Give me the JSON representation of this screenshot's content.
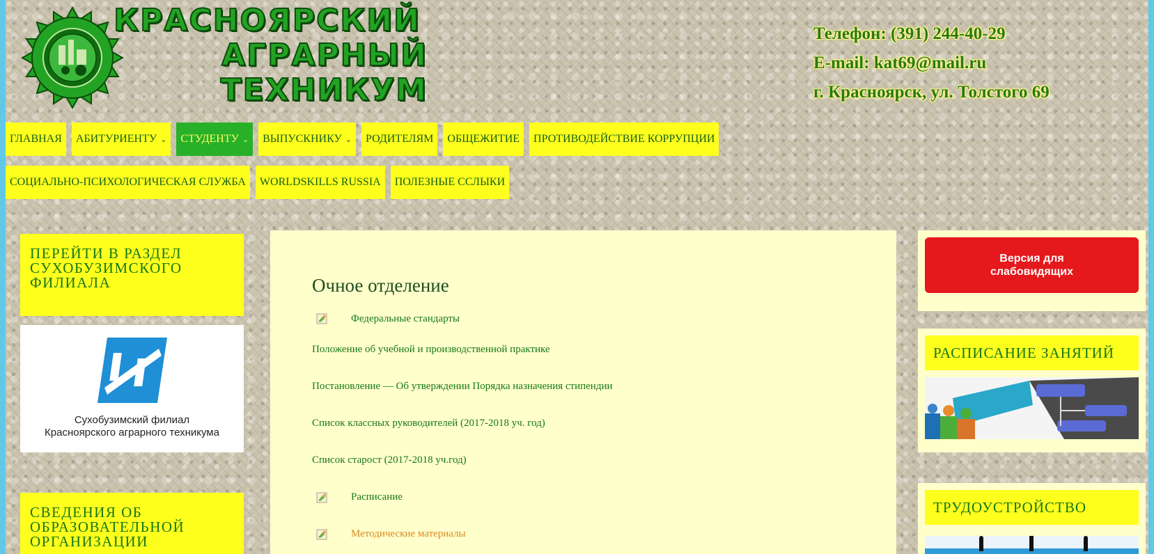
{
  "header": {
    "logo_lines": [
      "КРАСНОЯРСКИЙ",
      "АГРАРНЫЙ",
      "ТЕХНИКУМ"
    ],
    "phone": "Телефон: (391) 244-40-29",
    "email": "E-mail: kat69@mail.ru",
    "address": "г. Красноярск, ул. Толстого 69"
  },
  "nav": {
    "row1": [
      {
        "label": "ГЛАВНАЯ",
        "dropdown": false,
        "active": false
      },
      {
        "label": "АБИТУРИЕНТУ",
        "dropdown": true,
        "active": false
      },
      {
        "label": "СТУДЕНТУ",
        "dropdown": true,
        "active": true
      },
      {
        "label": "ВЫПУСКНИКУ",
        "dropdown": true,
        "active": false
      },
      {
        "label": "РОДИТЕЛЯМ",
        "dropdown": false,
        "active": false
      },
      {
        "label": "ОБЩЕЖИТИЕ",
        "dropdown": false,
        "active": false
      },
      {
        "label": "ПРОТИВОДЕЙСТВИЕ КОРРУПЦИИ",
        "dropdown": false,
        "active": false
      }
    ],
    "row2": [
      {
        "label": "СОЦИАЛЬНО-ПСИХОЛОГИЧЕСКАЯ СЛУЖБА"
      },
      {
        "label": "WORLDSKILLS RUSSIA"
      },
      {
        "label": "ПОЛЕЗНЫЕ ССЛЫКИ"
      }
    ],
    "caret": "⌄"
  },
  "left_sidebar": {
    "filial_link": "ПЕРЕЙТИ В РАЗДЕЛ СУХОБУЗИМСКОГО ФИЛИАЛА",
    "filial_caption_1": "Сухобузимский филиал",
    "filial_caption_2": "Красноярского аграрного техникума",
    "org_info": "СВЕДЕНИЯ ОБ ОБРАЗОВАТЕЛЬНОЙ ОРГАНИЗАЦИИ"
  },
  "main": {
    "title": "Очное отделение",
    "links": [
      {
        "text": "Федеральные стандарты",
        "icon": "file-icon",
        "color": "green"
      },
      {
        "text": "Положение об учебной и производственной практике",
        "icon": null,
        "color": "green"
      },
      {
        "text": "Постановление — Об утверждении Порядка назначения стипендии",
        "icon": null,
        "color": "green"
      },
      {
        "text": "Список классных руководителей (2017-2018 уч. год)",
        "icon": null,
        "color": "green"
      },
      {
        "text": "Список старост (2017-2018 уч.год)",
        "icon": null,
        "color": "green"
      },
      {
        "text": "Расписание",
        "icon": "file-icon",
        "color": "green"
      },
      {
        "text": "Методические материалы",
        "icon": "file-icon",
        "color": "orange"
      }
    ]
  },
  "right_sidebar": {
    "vision_button_1": "Версия для",
    "vision_button_2": "слабовидящих",
    "schedule_title": "РАСПИСАНИЕ ЗАНЯТИЙ",
    "jobs_title": "ТРУДОУСТРОЙСТВО"
  },
  "colors": {
    "nav_bg": "#ffff1e",
    "nav_active": "#28b128",
    "text_green": "#167816",
    "content_bg": "#ffffcc",
    "vision_red": "#e5181c",
    "frame_blue": "#62c8e8"
  }
}
